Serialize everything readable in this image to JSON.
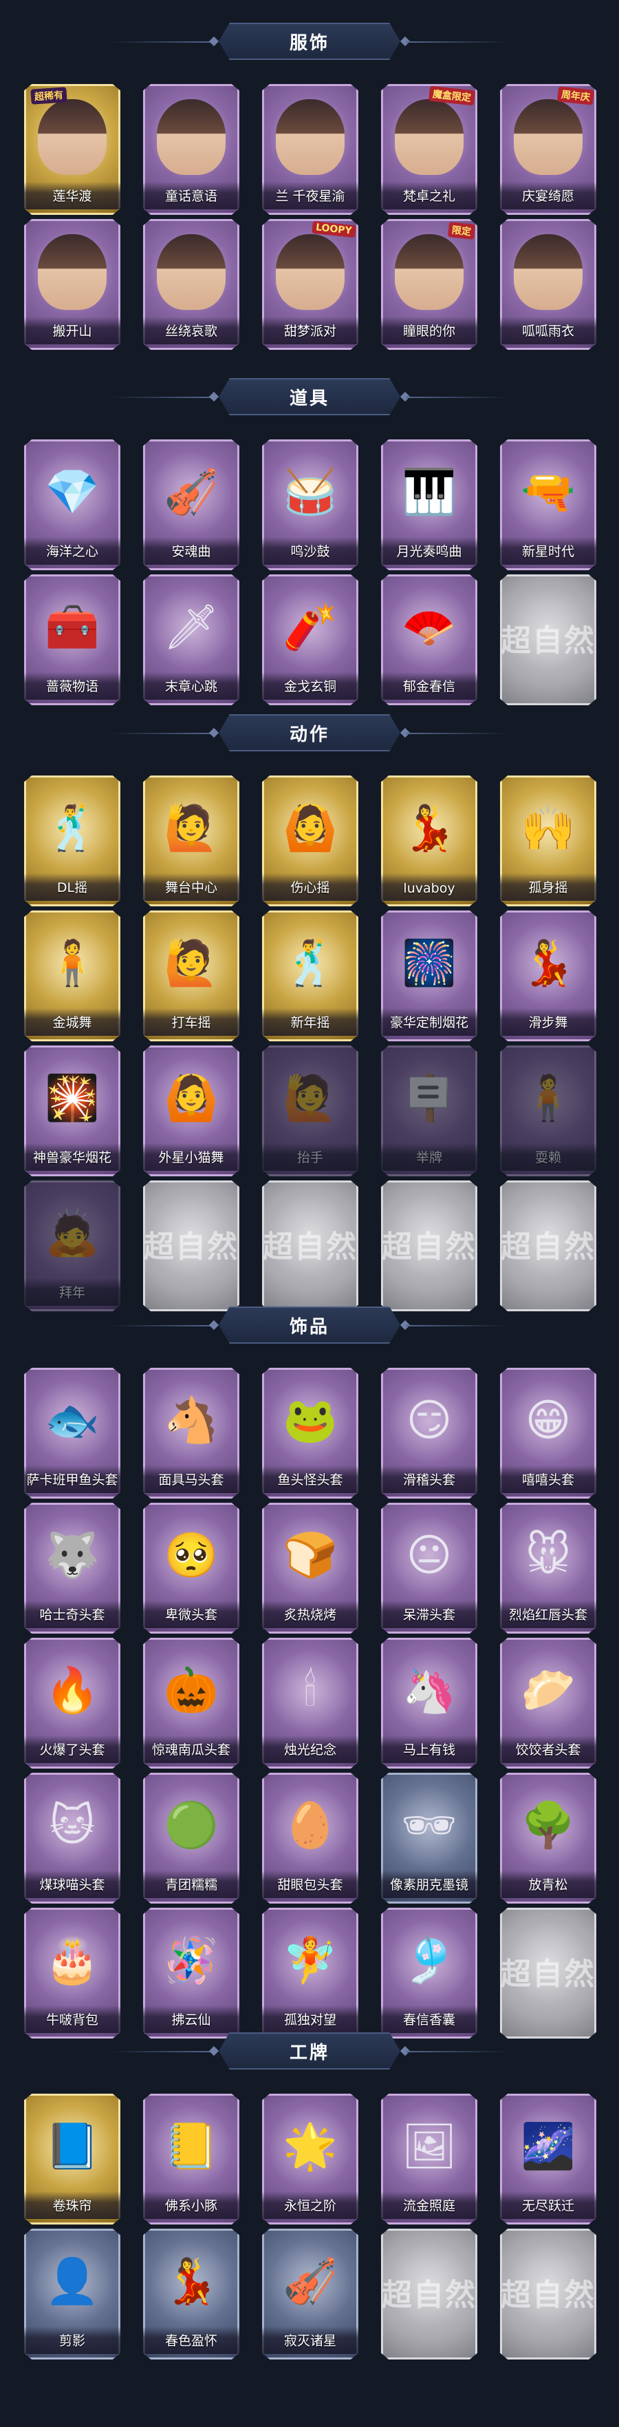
{
  "colors": {
    "background": "#131a26",
    "purple_card": "#8a68a6",
    "gold_card": "#caa645",
    "blue_card": "#5d6a8a",
    "empty_card": "#a8a8ae",
    "header_banner": "#2c3a57"
  },
  "placeholder_text": "超自然",
  "sections": [
    {
      "title": "服饰",
      "items": [
        {
          "name": "莲华渡",
          "style": "gold",
          "icon": "character-portrait",
          "tag": "超稀有"
        },
        {
          "name": "童话意语",
          "style": "purple",
          "icon": "character-portrait"
        },
        {
          "name": "兰 千夜星渝",
          "style": "purple",
          "icon": "character-portrait"
        },
        {
          "name": "梵卓之礼",
          "style": "purple",
          "icon": "character-portrait",
          "tag": "魔盒限定"
        },
        {
          "name": "庆宴绮愿",
          "style": "purple",
          "icon": "character-portrait",
          "tag": "周年庆"
        },
        {
          "name": "搬开山",
          "style": "purple",
          "icon": "character-portrait"
        },
        {
          "name": "丝绕哀歌",
          "style": "purple",
          "icon": "character-portrait"
        },
        {
          "name": "甜梦派对",
          "style": "purple",
          "icon": "character-portrait",
          "tag": "LOOPY"
        },
        {
          "name": "瞳眼的你",
          "style": "purple",
          "icon": "character-portrait",
          "tag": "限定"
        },
        {
          "name": "呱呱雨衣",
          "style": "purple",
          "icon": "character-portrait"
        }
      ]
    },
    {
      "title": "道具",
      "items": [
        {
          "name": "海洋之心",
          "style": "purple",
          "icon": "necklace-icon",
          "glyph": "💎"
        },
        {
          "name": "安魂曲",
          "style": "purple",
          "icon": "violin-icon",
          "glyph": "🎻"
        },
        {
          "name": "鸣沙鼓",
          "style": "purple",
          "icon": "drum-icon",
          "glyph": "🥁"
        },
        {
          "name": "月光奏鸣曲",
          "style": "purple",
          "icon": "piano-icon",
          "glyph": "🎹"
        },
        {
          "name": "新星时代",
          "style": "purple",
          "icon": "pistol-icon",
          "glyph": "🔫"
        },
        {
          "name": "蔷薇物语",
          "style": "purple",
          "icon": "medkit-icon",
          "glyph": "🧰"
        },
        {
          "name": "末章心跳",
          "style": "purple",
          "icon": "sword-icon",
          "glyph": "🗡"
        },
        {
          "name": "金戈玄铜",
          "style": "purple",
          "icon": "grenade-icon",
          "glyph": "🧨"
        },
        {
          "name": "郁金春信",
          "style": "purple",
          "icon": "fan-icon",
          "glyph": "🪭"
        },
        {
          "name": "",
          "style": "empty",
          "icon": "placeholder-icon"
        }
      ]
    },
    {
      "title": "动作",
      "items": [
        {
          "name": "DL摇",
          "style": "gold",
          "icon": "emote-figure-icon",
          "glyph": "🕺"
        },
        {
          "name": "舞台中心",
          "style": "gold",
          "icon": "emote-figure-icon",
          "glyph": "🙋"
        },
        {
          "name": "伤心摇",
          "style": "gold",
          "icon": "emote-figure-icon",
          "glyph": "🙆"
        },
        {
          "name": "luvaboy",
          "style": "gold",
          "icon": "emote-figure-icon",
          "glyph": "💃"
        },
        {
          "name": "孤身摇",
          "style": "gold",
          "icon": "emote-figure-icon",
          "glyph": "🙌"
        },
        {
          "name": "金城舞",
          "style": "gold",
          "icon": "emote-figure-icon",
          "glyph": "🧍"
        },
        {
          "name": "打车摇",
          "style": "gold",
          "icon": "emote-figure-icon",
          "glyph": "🙋"
        },
        {
          "name": "新年摇",
          "style": "gold",
          "icon": "emote-figure-icon",
          "glyph": "🕺"
        },
        {
          "name": "豪华定制烟花",
          "style": "purple",
          "icon": "fireworks-icon",
          "glyph": "🎆"
        },
        {
          "name": "滑步舞",
          "style": "purple",
          "icon": "emote-figure-icon",
          "glyph": "💃"
        },
        {
          "name": "神兽豪华烟花",
          "style": "purple",
          "icon": "fireworks-icon",
          "glyph": "🎇"
        },
        {
          "name": "外星小猫舞",
          "style": "purple",
          "icon": "emote-figure-icon",
          "glyph": "🙆"
        },
        {
          "name": "抬手",
          "style": "purple",
          "icon": "emote-figure-icon",
          "glyph": "🙋",
          "ghost": true
        },
        {
          "name": "举牌",
          "style": "purple",
          "icon": "emote-figure-icon",
          "glyph": "🪧",
          "ghost": true
        },
        {
          "name": "耍赖",
          "style": "purple",
          "icon": "emote-figure-icon",
          "glyph": "🧍",
          "ghost": true
        },
        {
          "name": "拜年",
          "style": "purple",
          "icon": "emote-figure-icon",
          "glyph": "🙇",
          "ghost": true
        },
        {
          "name": "",
          "style": "empty",
          "icon": "placeholder-icon"
        },
        {
          "name": "",
          "style": "empty",
          "icon": "placeholder-icon"
        },
        {
          "name": "",
          "style": "empty",
          "icon": "placeholder-icon"
        },
        {
          "name": "",
          "style": "empty",
          "icon": "placeholder-icon"
        }
      ]
    },
    {
      "title": "饰品",
      "items": [
        {
          "name": "萨卡班甲鱼头套",
          "style": "purple",
          "icon": "fish-head-icon",
          "glyph": "🐟"
        },
        {
          "name": "面具马头套",
          "style": "purple",
          "icon": "horse-head-icon",
          "glyph": "🐴"
        },
        {
          "name": "鱼头怪头套",
          "style": "purple",
          "icon": "fish-monster-icon",
          "glyph": "🐸"
        },
        {
          "name": "滑稽头套",
          "style": "purple",
          "icon": "smirk-face-icon",
          "glyph": "😏"
        },
        {
          "name": "嘻嘻头套",
          "style": "purple",
          "icon": "grin-face-icon",
          "glyph": "😁"
        },
        {
          "name": "哈士奇头套",
          "style": "purple",
          "icon": "husky-head-icon",
          "glyph": "🐺"
        },
        {
          "name": "卑微头套",
          "style": "purple",
          "icon": "sad-face-icon",
          "glyph": "🥺"
        },
        {
          "name": "炙热烧烤",
          "style": "purple",
          "icon": "toast-icon",
          "glyph": "🍞"
        },
        {
          "name": "呆滞头套",
          "style": "purple",
          "icon": "dazed-face-icon",
          "glyph": "😐"
        },
        {
          "name": "烈焰红唇头套",
          "style": "purple",
          "icon": "pikachu-head-icon",
          "glyph": "🐭"
        },
        {
          "name": "火爆了头套",
          "style": "purple",
          "icon": "fire-head-icon",
          "glyph": "🔥"
        },
        {
          "name": "惊魂南瓜头套",
          "style": "purple",
          "icon": "pumpkin-icon",
          "glyph": "🎃"
        },
        {
          "name": "烛光纪念",
          "style": "purple",
          "icon": "candle-icon",
          "glyph": "🕯"
        },
        {
          "name": "马上有钱",
          "style": "purple",
          "icon": "pony-icon",
          "glyph": "🦄"
        },
        {
          "name": "饺饺者头套",
          "style": "purple",
          "icon": "dumpling-icon",
          "glyph": "🥟"
        },
        {
          "name": "煤球喵头套",
          "style": "purple",
          "icon": "black-cat-icon",
          "glyph": "🐱"
        },
        {
          "name": "青团糯糯",
          "style": "purple",
          "icon": "green-bun-icon",
          "glyph": "🟢"
        },
        {
          "name": "甜眼包头套",
          "style": "purple",
          "icon": "egg-head-icon",
          "glyph": "🥚"
        },
        {
          "name": "像素朋克墨镜",
          "style": "blue",
          "icon": "pixel-glasses-icon",
          "glyph": "🕶"
        },
        {
          "name": "放青松",
          "style": "purple",
          "icon": "bonsai-icon",
          "glyph": "🌳"
        },
        {
          "name": "牛啵背包",
          "style": "purple",
          "icon": "cake-backpack-icon",
          "glyph": "🎂"
        },
        {
          "name": "拂云仙",
          "style": "purple",
          "icon": "charm-icon",
          "glyph": "🪅"
        },
        {
          "name": "孤独对望",
          "style": "purple",
          "icon": "figurine-icon",
          "glyph": "🧚"
        },
        {
          "name": "春信香囊",
          "style": "purple",
          "icon": "sachet-icon",
          "glyph": "🎐"
        },
        {
          "name": "",
          "style": "empty",
          "icon": "placeholder-icon"
        }
      ]
    },
    {
      "title": "工牌",
      "items": [
        {
          "name": "卷珠帘",
          "style": "gold",
          "icon": "badge-icon",
          "glyph": "📘"
        },
        {
          "name": "佛系小豚",
          "style": "purple",
          "icon": "badge-icon",
          "glyph": "📒"
        },
        {
          "name": "永恒之阶",
          "style": "purple",
          "icon": "badge-icon",
          "glyph": "🌟"
        },
        {
          "name": "流金照庭",
          "style": "purple",
          "icon": "badge-icon",
          "glyph": "🖼"
        },
        {
          "name": "无尽跃迁",
          "style": "purple",
          "icon": "badge-icon",
          "glyph": "🌌"
        },
        {
          "name": "剪影",
          "style": "blue",
          "icon": "silhouette-badge-icon",
          "glyph": "👤"
        },
        {
          "name": "春色盈怀",
          "style": "blue",
          "icon": "silhouette-badge-icon",
          "glyph": "💃"
        },
        {
          "name": "寂灭诸星",
          "style": "blue",
          "icon": "silhouette-badge-icon",
          "glyph": "🎻"
        },
        {
          "name": "",
          "style": "empty",
          "icon": "placeholder-icon"
        },
        {
          "name": "",
          "style": "empty",
          "icon": "placeholder-icon"
        }
      ]
    }
  ]
}
